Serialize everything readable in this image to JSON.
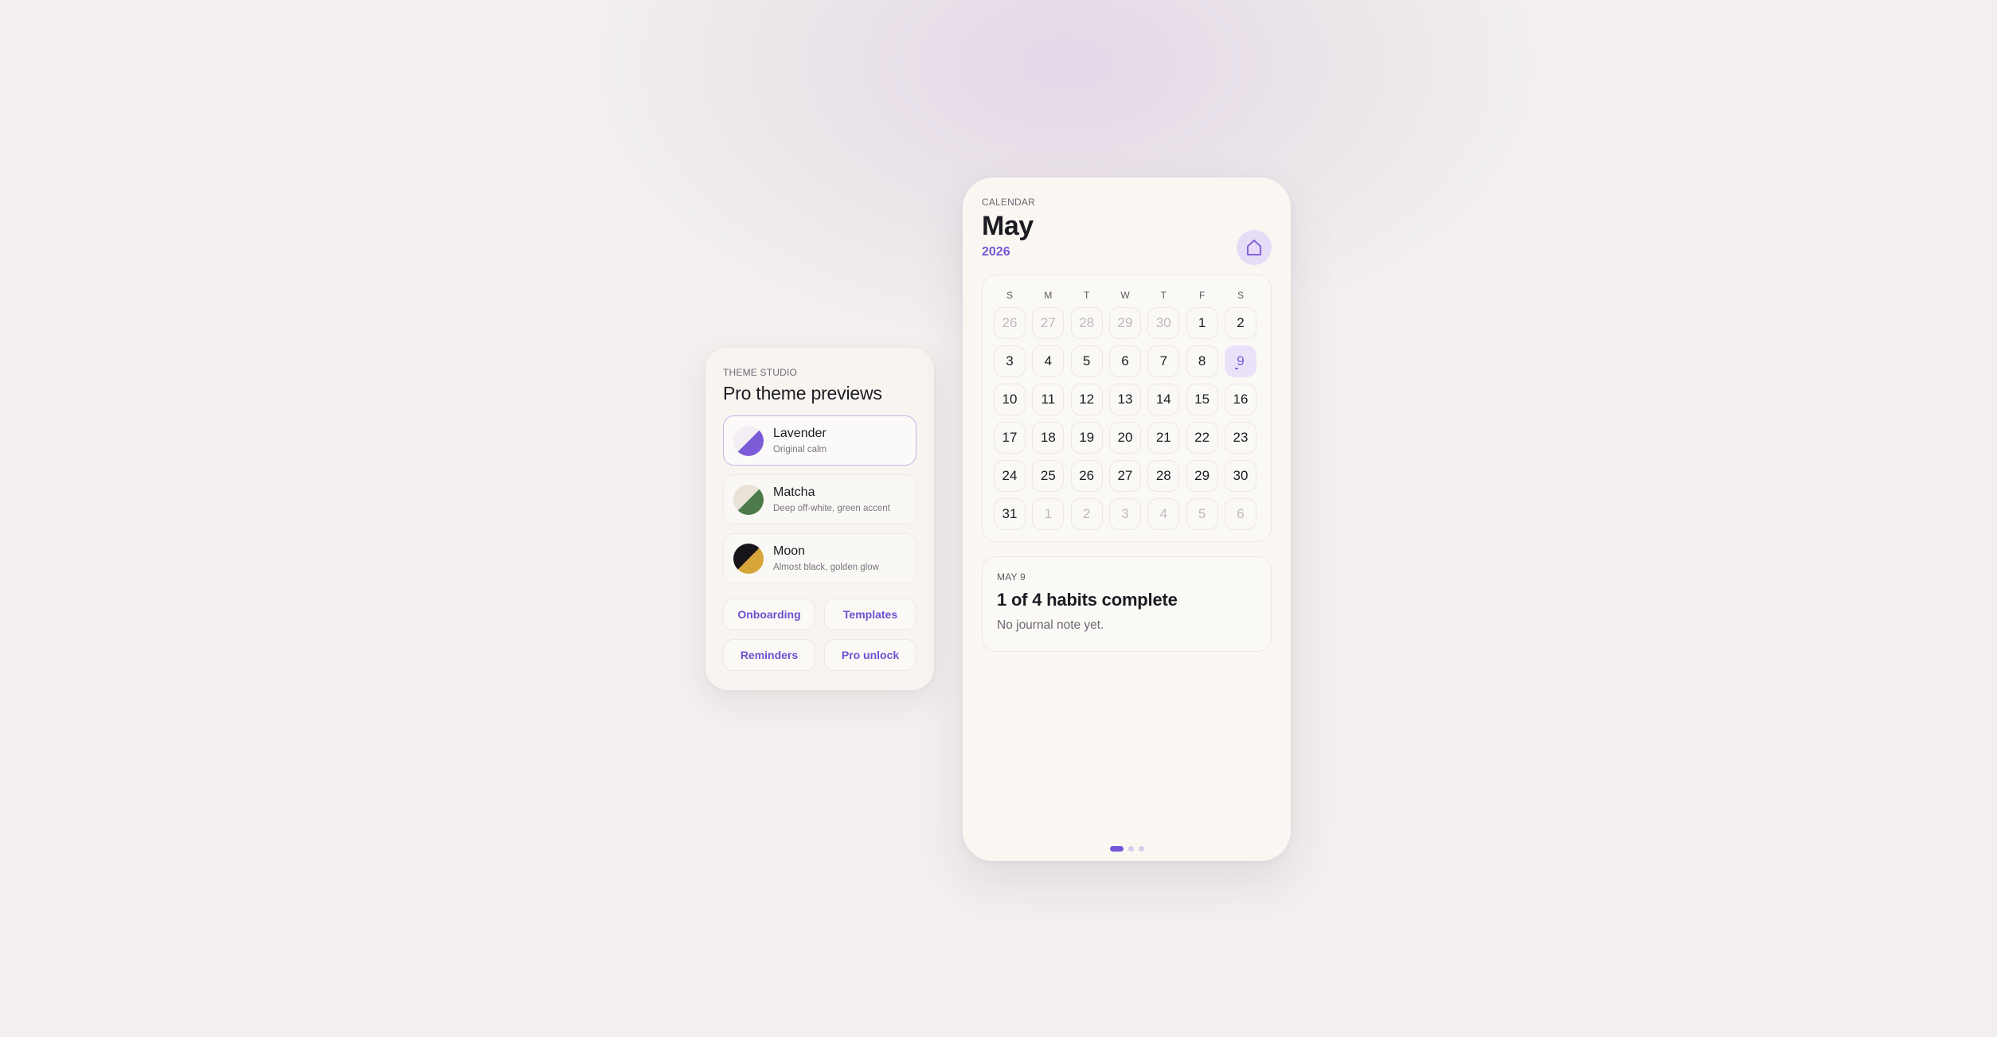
{
  "theme_studio": {
    "eyebrow": "THEME STUDIO",
    "title": "Pro theme previews",
    "themes": [
      {
        "name": "Lavender",
        "description": "Original calm",
        "selected": true,
        "colors": [
          "#f2eef3",
          "#7b5bd8"
        ]
      },
      {
        "name": "Matcha",
        "description": "Deep off-white, green accent",
        "selected": false,
        "colors": [
          "#e8e2d8",
          "#4c7a4a"
        ]
      },
      {
        "name": "Moon",
        "description": "Almost black, golden glow",
        "selected": false,
        "colors": [
          "#17151a",
          "#d6a63a"
        ]
      }
    ],
    "quick_links": [
      "Onboarding",
      "Templates",
      "Reminders",
      "Pro unlock"
    ]
  },
  "calendar": {
    "eyebrow": "CALENDAR",
    "month": "May",
    "year": "2026",
    "home_icon": "home-icon",
    "weekdays": [
      "S",
      "M",
      "T",
      "W",
      "T",
      "F",
      "S"
    ],
    "weeks": [
      [
        {
          "d": "26",
          "m": true
        },
        {
          "d": "27",
          "m": true
        },
        {
          "d": "28",
          "m": true
        },
        {
          "d": "29",
          "m": true
        },
        {
          "d": "30",
          "m": true
        },
        {
          "d": "1"
        },
        {
          "d": "2"
        }
      ],
      [
        {
          "d": "3"
        },
        {
          "d": "4"
        },
        {
          "d": "5"
        },
        {
          "d": "6"
        },
        {
          "d": "7"
        },
        {
          "d": "8"
        },
        {
          "d": "9",
          "today": true
        }
      ],
      [
        {
          "d": "10"
        },
        {
          "d": "11"
        },
        {
          "d": "12"
        },
        {
          "d": "13"
        },
        {
          "d": "14"
        },
        {
          "d": "15"
        },
        {
          "d": "16"
        }
      ],
      [
        {
          "d": "17"
        },
        {
          "d": "18"
        },
        {
          "d": "19"
        },
        {
          "d": "20"
        },
        {
          "d": "21"
        },
        {
          "d": "22"
        },
        {
          "d": "23"
        }
      ],
      [
        {
          "d": "24"
        },
        {
          "d": "25"
        },
        {
          "d": "26"
        },
        {
          "d": "27"
        },
        {
          "d": "28"
        },
        {
          "d": "29"
        },
        {
          "d": "30"
        }
      ],
      [
        {
          "d": "31"
        },
        {
          "d": "1",
          "m": true
        },
        {
          "d": "2",
          "m": true
        },
        {
          "d": "3",
          "m": true
        },
        {
          "d": "4",
          "m": true
        },
        {
          "d": "5",
          "m": true
        },
        {
          "d": "6",
          "m": true
        }
      ]
    ],
    "selected_day": {
      "date_label": "MAY 9",
      "title": "1 of 4 habits complete",
      "note": "No journal note yet."
    },
    "pager": {
      "count": 3,
      "active": 0
    }
  },
  "colors": {
    "accent": "#7556d6",
    "accent_soft": "#ebe2fa",
    "background": "#f2efee",
    "card": "#faf7f2"
  }
}
